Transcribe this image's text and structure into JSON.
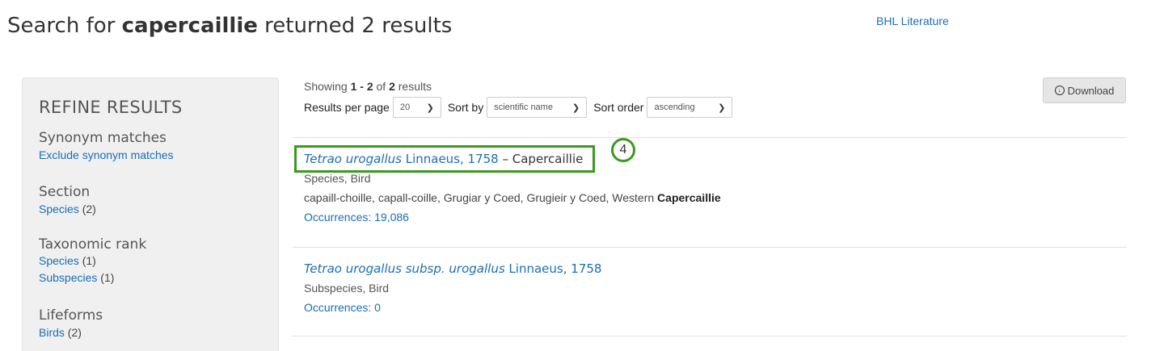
{
  "header": {
    "title_prefix": "Search for ",
    "query": "capercaillie",
    "title_suffix": " returned 2 results",
    "bhl_link": "BHL Literature"
  },
  "sidebar": {
    "title": "REFINE RESULTS",
    "facets": [
      {
        "heading": "Synonym matches",
        "items": [
          {
            "label": "Exclude synonym matches",
            "count": ""
          }
        ]
      },
      {
        "heading": "Section",
        "items": [
          {
            "label": "Species",
            "count": "(2)"
          }
        ]
      },
      {
        "heading": "Taxonomic rank",
        "items": [
          {
            "label": "Species",
            "count": "(1)"
          },
          {
            "label": "Subspecies",
            "count": "(1)"
          }
        ]
      },
      {
        "heading": "Lifeforms",
        "items": [
          {
            "label": "Birds",
            "count": "(2)"
          }
        ]
      }
    ]
  },
  "toolbar": {
    "showing_prefix": "Showing ",
    "showing_range": "1 - 2",
    "showing_of": " of ",
    "showing_total": "2",
    "showing_suffix": " results",
    "per_page_label": "Results per page",
    "per_page_value": "20",
    "sort_by_label": "Sort by",
    "sort_by_value": "scientific name",
    "sort_order_label": "Sort order",
    "sort_order_value": "ascending",
    "download_label": "Download"
  },
  "results": [
    {
      "sci_name": "Tetrao urogallus",
      "authority": " Linnaeus, 1758",
      "common": " – Capercaillie",
      "meta": "Species, Bird",
      "names_prefix": "capaill-choille, capall-coille, Grugiar y Coed, Grugieir y Coed, Western ",
      "names_match": "Capercaillie",
      "occurrences": "Occurrences: 19,086"
    },
    {
      "sci_name": "Tetrao urogallus subsp. urogallus",
      "authority": " Linnaeus, 1758",
      "meta": "Subspecies, Bird",
      "occurrences": "Occurrences: 0"
    }
  ],
  "annotation": {
    "badge_number": "4",
    "color": "#3a9a1f"
  },
  "colors": {
    "link": "#1a6eb5",
    "sidebar_bg": "#f0f0f0"
  }
}
